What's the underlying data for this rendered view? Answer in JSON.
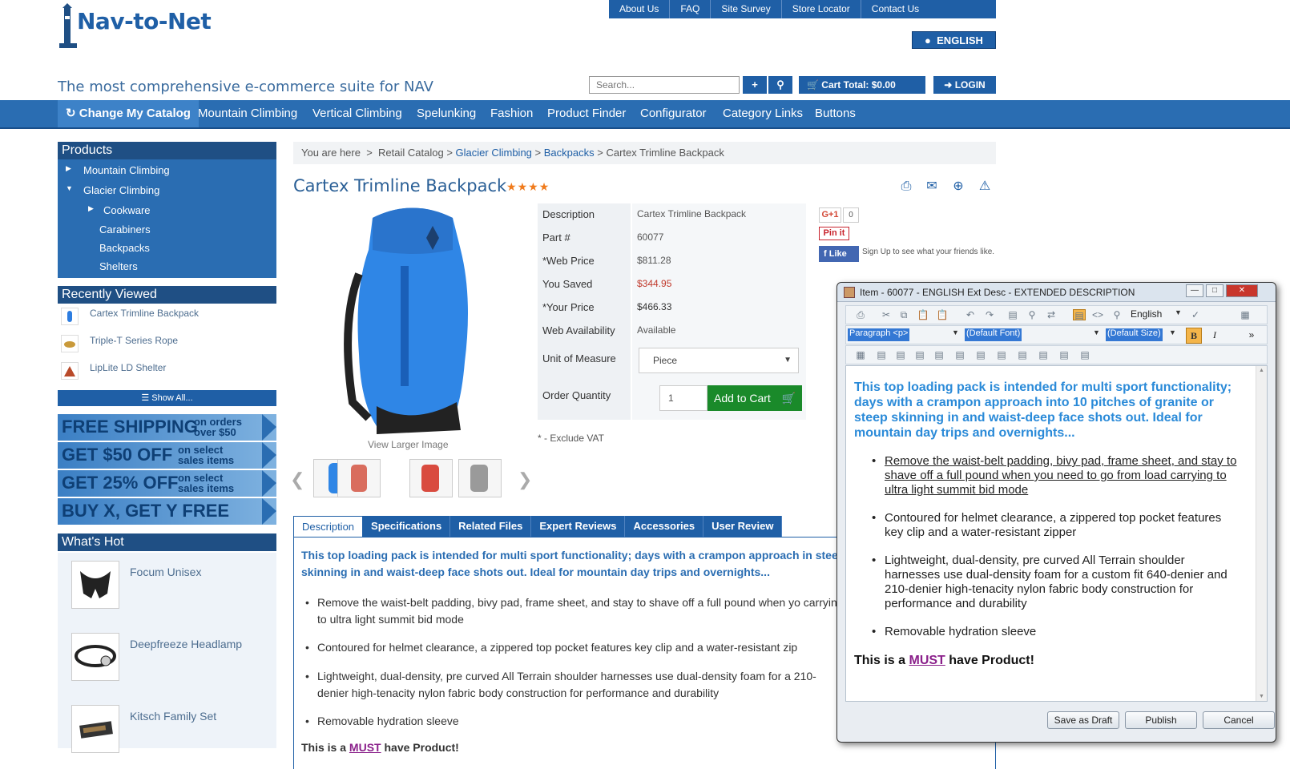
{
  "header": {
    "logo": "Nav-to-Net",
    "tagline": "The most comprehensive e-commerce suite for NAV",
    "top_links": [
      "About Us",
      "FAQ",
      "Site Survey",
      "Store Locator",
      "Contact Us"
    ],
    "language": "ENGLISH",
    "search_placeholder": "Search...",
    "cart_total": "Cart Total: $0.00",
    "login": "LOGIN"
  },
  "main_nav": {
    "active": "Change My Catalog",
    "items": [
      "Mountain Climbing",
      "Vertical Climbing",
      "Spelunking",
      "Fashion",
      "Product Finder",
      "Configurator",
      "Category Links",
      "Buttons"
    ]
  },
  "sidebar": {
    "products_title": "Products",
    "products": [
      "Mountain Climbing",
      "Glacier Climbing",
      "Cookware",
      "Carabiners",
      "Backpacks",
      "Shelters"
    ],
    "recent_title": "Recently Viewed",
    "recent": [
      "Cartex Trimline Backpack",
      "Triple-T Series Rope",
      "LipLite LD Shelter"
    ],
    "show_all": "Show All...",
    "banners": [
      {
        "big": "FREE SHIPPING",
        "small1": "on orders",
        "small2": "over $50"
      },
      {
        "big": "GET $50 OFF",
        "small1": "on select",
        "small2": "sales items"
      },
      {
        "big": "GET 25% OFF",
        "small1": "on select",
        "small2": "sales items"
      },
      {
        "big": "BUY X, GET Y FREE",
        "small1": "",
        "small2": ""
      }
    ],
    "hot_title": "What's Hot",
    "hot": [
      "Focum Unisex",
      "Deepfreeze Headlamp",
      "Kitsch Family Set"
    ]
  },
  "breadcrumb": {
    "prefix": "You are here",
    "sep": ">",
    "items": [
      "Retail Catalog",
      "Glacier Climbing",
      "Backpacks",
      "Cartex Trimline Backpack"
    ]
  },
  "product": {
    "title": "Cartex Trimline Backpack",
    "rating": 4,
    "view_larger": "View Larger Image",
    "details": [
      {
        "label": "Description",
        "value": "Cartex Trimline Backpack"
      },
      {
        "label": "Part #",
        "value": "60077"
      },
      {
        "label": "*Web Price",
        "value": "$811.28"
      },
      {
        "label": "You Saved",
        "value": "$344.95"
      },
      {
        "label": "*Your Price",
        "value": "$466.33"
      },
      {
        "label": "Web Availability",
        "value": "Available"
      },
      {
        "label": "Unit of Measure",
        "value": "Piece"
      },
      {
        "label": "Order Quantity",
        "value": "1"
      }
    ],
    "add_to_cart": "Add to Cart",
    "exclude_vat": "* - Exclude VAT",
    "social": {
      "gplus": "G+1",
      "gcount": "0",
      "pin": "Pin it",
      "like": "Like",
      "fb_text": "Sign Up to see what your friends like."
    }
  },
  "tabs": [
    "Description",
    "Specifications",
    "Related Files",
    "Expert Reviews",
    "Accessories",
    "User Review"
  ],
  "description": {
    "intro": "This top loading pack is intended for multi sport functionality; days with a crampon approach in steep skinning in and waist-deep face shots out. Ideal for mountain day trips and overnights...",
    "bullets": [
      "Remove the waist-belt padding, bivy pad, frame sheet, and stay to shave off a full pound when yo carrying to ultra light summit bid mode",
      "Contoured for helmet clearance, a zippered top pocket features key clip and a water-resistant zip",
      "Lightweight, dual-density, pre curved All Terrain shoulder harnesses use dual-density foam for a 210-denier high-tenacity nylon fabric body construction for performance and durability",
      "Removable hydration sleeve"
    ],
    "must_pre": "This is a",
    "must_word": "MUST",
    "must_post": "have Product!"
  },
  "editor": {
    "title": "Item - 60077 - ENGLISH Ext Desc - EXTENDED DESCRIPTION",
    "language": "English",
    "paragraph": "Paragraph <p>",
    "font": "(Default Font)",
    "size": "(Default Size)",
    "bold": "B",
    "italic": "I",
    "intro": "This top loading pack is intended for multi sport functionality; days with a crampon approach into 10 pitches of granite or steep skinning in and waist-deep face shots out. Ideal for mountain day trips and overnights...",
    "bullets": [
      "Remove the waist-belt padding, bivy pad, frame sheet, and stay to shave off a full pound when you need to go from load carrying to ultra light summit bid mode",
      "Contoured for helmet clearance, a zippered top pocket features key clip and a water-resistant zipper",
      "Lightweight, dual-density, pre curved All Terrain shoulder harnesses use dual-density foam for a custom fit 640-denier and 210-denier high-tenacity nylon fabric body construction for performance and durability",
      "Removable hydration sleeve"
    ],
    "buttons": [
      "Save as Draft",
      "Publish",
      "Cancel"
    ]
  },
  "colors": {
    "brand": "#1f5fa6",
    "nav": "#2a6db2",
    "accent": "#f07b1c",
    "save_red": "#c0392b",
    "cart_green": "#1a8a2a"
  }
}
